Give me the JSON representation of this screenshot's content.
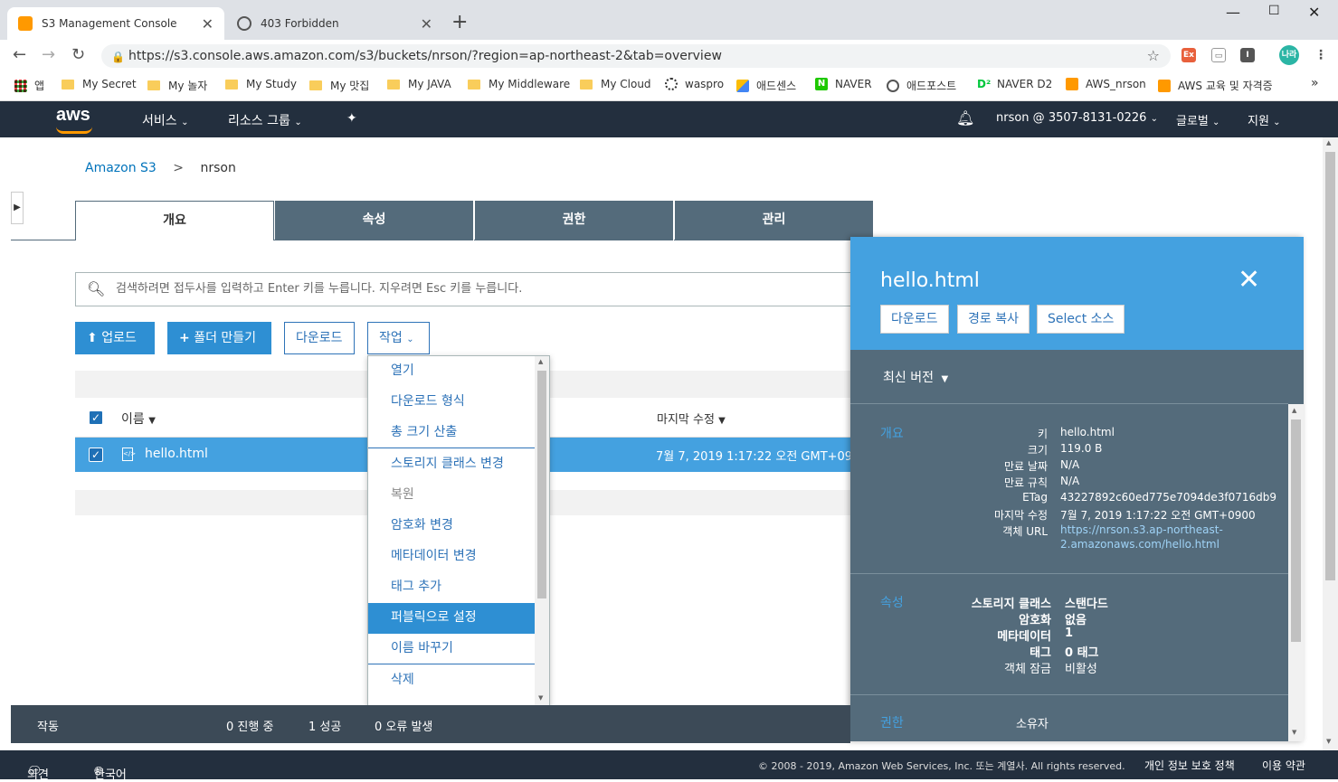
{
  "browser": {
    "tabs": [
      {
        "title": "S3 Management Console",
        "active": true
      },
      {
        "title": "403 Forbidden",
        "active": false
      }
    ],
    "url": "https://s3.console.aws.amazon.com/s3/buckets/nrson/?region=ap-northeast-2&tab=overview",
    "bookmarks": [
      "앱",
      "My Secret",
      "My 놀자",
      "My Study",
      "My 맛집",
      "My JAVA",
      "My Middleware",
      "My Cloud",
      "waspro",
      "애드센스",
      "NAVER",
      "애드포스트",
      "NAVER D2",
      "AWS_nrson",
      "AWS 교육 및 자격증"
    ],
    "more": "»",
    "profile": "나라"
  },
  "awsnav": {
    "logo": "aws",
    "services": "서비스",
    "resource_groups": "리소스 그룹",
    "account": "nrson @ 3507-8131-0226",
    "region": "글로벌",
    "support": "지원"
  },
  "breadcrumb": {
    "root": "Amazon S3",
    "sep": ">",
    "current": "nrson"
  },
  "tabs": [
    "개요",
    "속성",
    "권한",
    "관리"
  ],
  "search": {
    "placeholder": "검색하려면 접두사를 입력하고 Enter 키를 누릅니다. 지우려면 Esc 키를 누릅니다."
  },
  "actions": {
    "upload": "업로드",
    "create_folder": "폴더 만들기",
    "download": "다운로드",
    "actions": "작업"
  },
  "grid": {
    "col_name": "이름",
    "col_modified": "마지막 수정",
    "row": {
      "name": "hello.html",
      "modified": "7월 7, 2019 1:17:22 오전 GMT+09"
    }
  },
  "menu": {
    "items": [
      "열기",
      "다운로드 형식",
      "총 크기 산출",
      "스토리지 클래스 변경",
      "복원",
      "암호화 변경",
      "메타데이터 변경",
      "태그 추가",
      "퍼블릭으로 설정",
      "이름 바꾸기",
      "삭제"
    ],
    "highlighted": "퍼블릭으로 설정",
    "disabled": [
      "복원"
    ]
  },
  "panel": {
    "title": "hello.html",
    "buttons": [
      "다운로드",
      "경로 복사",
      "Select 소스"
    ],
    "version": "최신 버전",
    "overview_label": "개요",
    "overview": [
      {
        "k": "키",
        "v": "hello.html"
      },
      {
        "k": "크기",
        "v": "119.0 B"
      },
      {
        "k": "만료 날짜",
        "v": "N/A"
      },
      {
        "k": "만료 규칙",
        "v": "N/A"
      },
      {
        "k": "ETag",
        "v": "43227892c60ed775e7094de3f0716db9"
      },
      {
        "k": "마지막 수정",
        "v": "7월 7, 2019 1:17:22 오전 GMT+0900"
      },
      {
        "k": "객체 URL",
        "v": "https://nrson.s3.ap-northeast-2.amazonaws.com/hello.html"
      }
    ],
    "url_line1": "https://nrson.s3.ap-northeast-",
    "url_line2": "2.amazonaws.com/hello.html",
    "props_label": "속성",
    "props": [
      {
        "k": "스토리지 클래스",
        "v": "스탠다드"
      },
      {
        "k": "암호화",
        "v": "없음"
      },
      {
        "k": "메타데이터",
        "v": "1"
      },
      {
        "k": "태그",
        "v": "0 태그"
      },
      {
        "k": "객체 잠금",
        "v": "비활성"
      }
    ],
    "perm_label": "권한",
    "perm_value": "소유자"
  },
  "status": {
    "label": "작동",
    "in_progress": "0 진행 중",
    "success": "1 성공",
    "errors": "0 오류 발생"
  },
  "footer": {
    "feedback": "의견",
    "language": "한국어",
    "copyright": "© 2008 - 2019, Amazon Web Services, Inc. 또는 계열사. All rights reserved.",
    "privacy": "개인 정보 보호 정책",
    "terms": "이용 약관"
  },
  "colors": {
    "aws_nav": "#232f3e",
    "tab_dark": "#546b7b",
    "accent": "#2e8fd3",
    "panel_head": "#44a1e0",
    "orange": "#ff9900"
  }
}
